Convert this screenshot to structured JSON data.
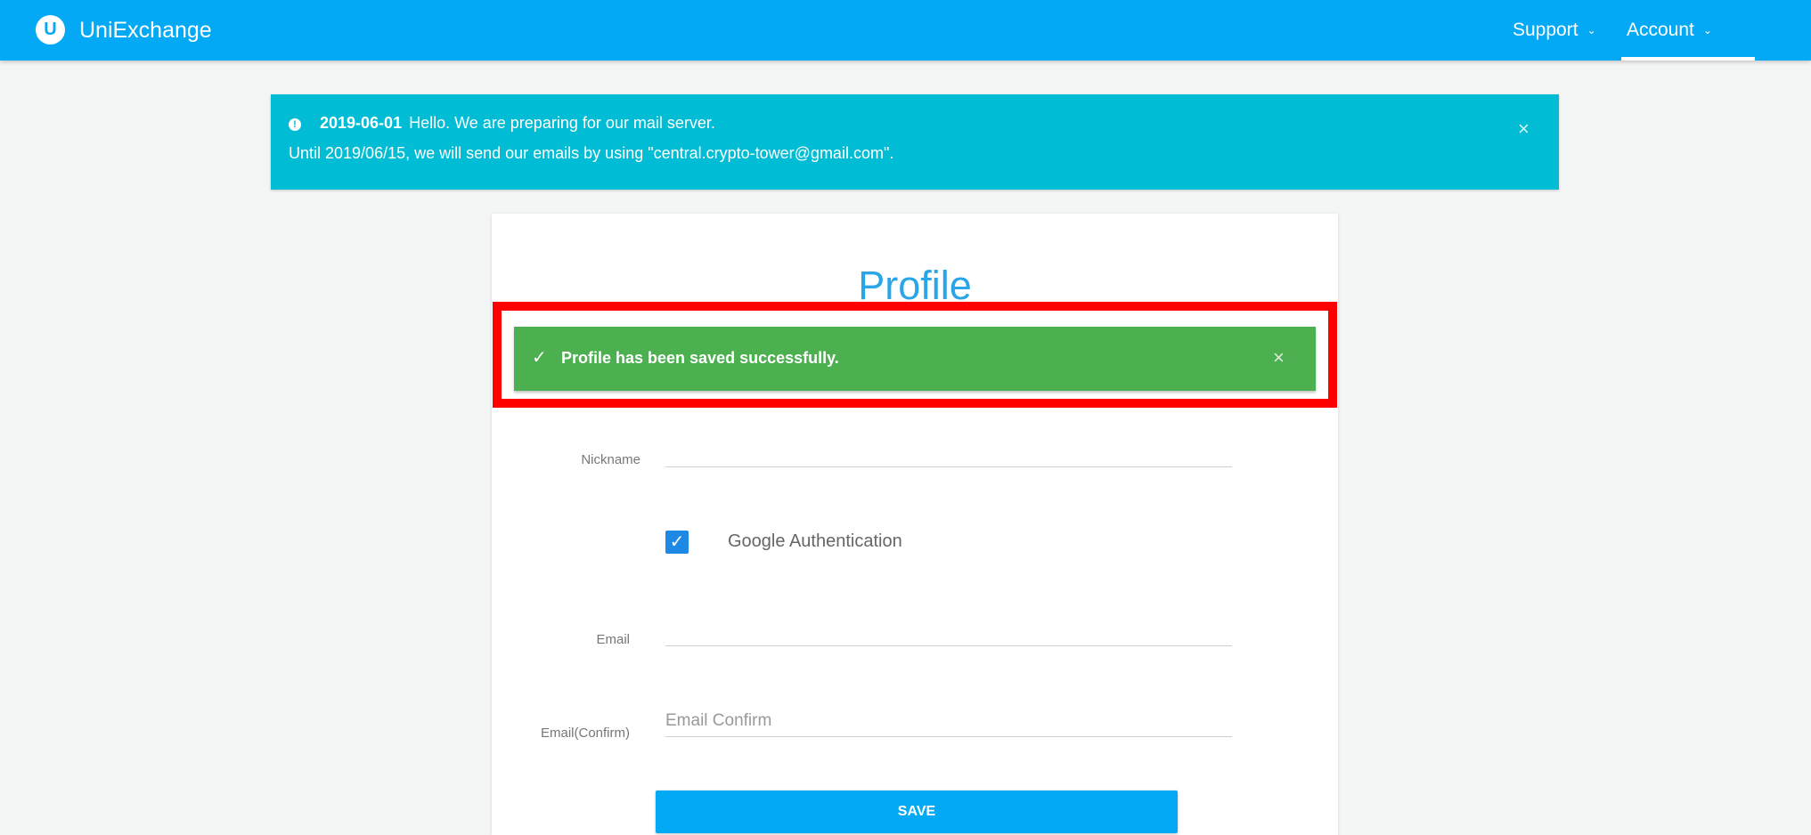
{
  "navbar": {
    "logo_letter": "U",
    "brand": "UniExchange",
    "support_label": "Support",
    "account_label": "Account",
    "chevron": "⌄",
    "color": "#03a9f4"
  },
  "announcement": {
    "icon": "info-icon",
    "icon_glyph": "!",
    "date": "2019-06-01",
    "line1": "Hello. We are preparing for our mail server.",
    "line2": "Until 2019/06/15, we will send our emails by using \"central.crypto-tower@gmail.com\".",
    "close_glyph": "×",
    "color": "#00bcd4"
  },
  "profile": {
    "title": "Profile",
    "alert": {
      "check_glyph": "✓",
      "message": "Profile has been saved successfully.",
      "close_glyph": "×",
      "color": "#4caf50"
    },
    "fields": {
      "nickname_label": "Nickname",
      "nickname_value": "",
      "google_auth_label": "Google Authentication",
      "google_auth_checked": true,
      "checkbox_glyph": "✓",
      "email_label": "Email",
      "email_value": "",
      "email_confirm_label": "Email(Confirm)",
      "email_confirm_placeholder": "Email Confirm"
    },
    "save_label": "SAVE"
  },
  "highlight_color": "#ff0000"
}
